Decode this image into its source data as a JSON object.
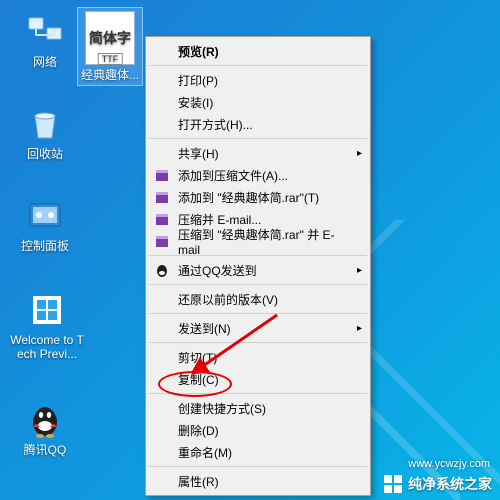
{
  "desktop_icons": {
    "network": {
      "label": "网络"
    },
    "font_file": {
      "label": "经典趣体...",
      "thumb_text": "简体字",
      "ext": "TTF"
    },
    "recycle": {
      "label": "回收站"
    },
    "control_panel": {
      "label": "控制面板"
    },
    "welcome": {
      "label": "Welcome to Tech Previ..."
    },
    "qq": {
      "label": "腾讯QQ"
    }
  },
  "context_menu": {
    "preview": "预览(R)",
    "print": "打印(P)",
    "install": "安装(I)",
    "open_with": "打开方式(H)...",
    "share": "共享(H)",
    "add_to_archive": "添加到压缩文件(A)...",
    "add_to_rar": "添加到 \"经典趣体简.rar\"(T)",
    "compress_email": "压缩并 E-mail...",
    "compress_rar_email": "压缩到 \"经典趣体简.rar\" 并 E-mail",
    "qq_send": "通过QQ发送到",
    "restore_versions": "还原以前的版本(V)",
    "send_to": "发送到(N)",
    "cut": "剪切(T)",
    "copy": "复制(C)",
    "create_shortcut": "创建快捷方式(S)",
    "delete": "删除(D)",
    "rename": "重命名(M)",
    "properties": "属性(R)"
  },
  "watermark": {
    "text": "纯净系统之家",
    "url": "www.ycwzjy.com"
  }
}
